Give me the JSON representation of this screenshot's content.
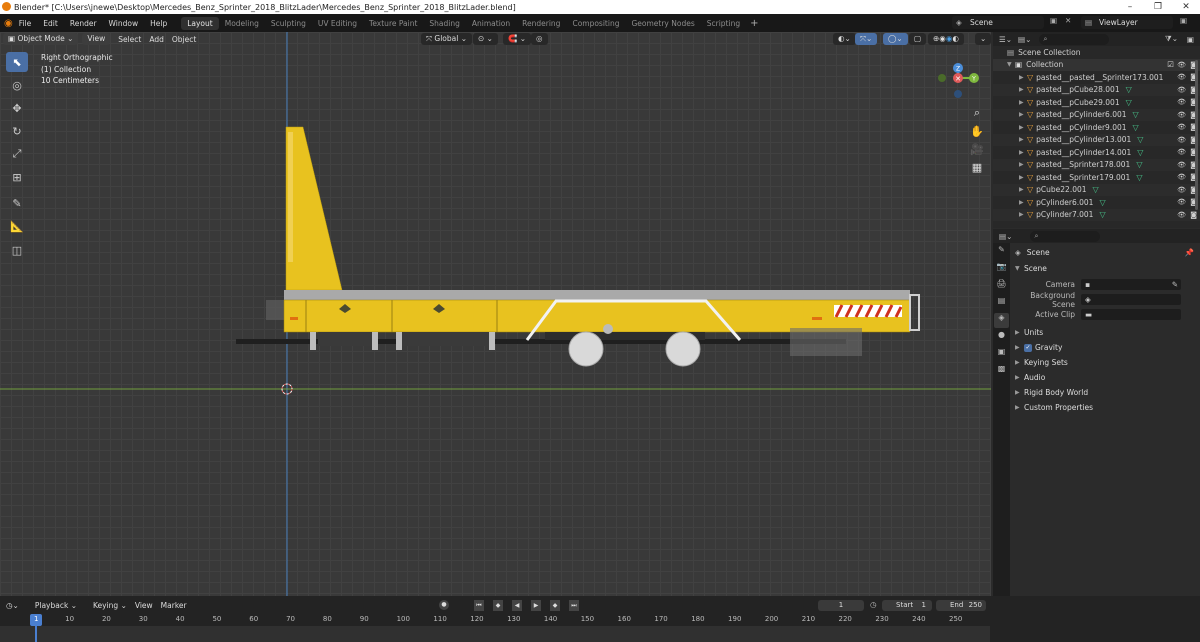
{
  "window": {
    "title": "Blender* [C:\\Users\\jnewe\\Desktop\\Mercedes_Benz_Sprinter_2018_BlitzLader\\Mercedes_Benz_Sprinter_2018_BlitzLader.blend]",
    "minimize": "–",
    "maximize": "❐",
    "close": "✕"
  },
  "menu": {
    "file": "File",
    "edit": "Edit",
    "render": "Render",
    "window": "Window",
    "help": "Help"
  },
  "workspaces": [
    "Layout",
    "Modeling",
    "Sculpting",
    "UV Editing",
    "Texture Paint",
    "Shading",
    "Animation",
    "Rendering",
    "Compositing",
    "Geometry Nodes",
    "Scripting"
  ],
  "scene_name": "Scene",
  "view_layer": "ViewLayer",
  "viewport": {
    "mode": "Object Mode",
    "view": "View",
    "select": "Select",
    "add": "Add",
    "object": "Object",
    "orientation": "Global",
    "overlay_info": [
      "Right Orthographic",
      "(1) Collection",
      "10 Centimeters"
    ]
  },
  "gizmo": {
    "z": "Z",
    "y": "Y"
  },
  "outliner": {
    "root": "Scene Collection",
    "collection": "Collection",
    "items": [
      {
        "name": "pasted__pasted__Sprinter173.001",
        "mesh": false
      },
      {
        "name": "pasted__pCube28.001",
        "mesh": true
      },
      {
        "name": "pasted__pCube29.001",
        "mesh": true
      },
      {
        "name": "pasted__pCylinder6.001",
        "mesh": true
      },
      {
        "name": "pasted__pCylinder9.001",
        "mesh": true
      },
      {
        "name": "pasted__pCylinder13.001",
        "mesh": true
      },
      {
        "name": "pasted__pCylinder14.001",
        "mesh": true
      },
      {
        "name": "pasted__Sprinter178.001",
        "mesh": true
      },
      {
        "name": "pasted__Sprinter179.001",
        "mesh": true
      },
      {
        "name": "pCube22.001",
        "mesh": true
      },
      {
        "name": "pCylinder6.001",
        "mesh": true
      },
      {
        "name": "pCylinder7.001",
        "mesh": true
      }
    ]
  },
  "properties": {
    "title": "Scene",
    "section": "Scene",
    "camera_label": "Camera",
    "background_label": "Background Scene",
    "clip_label": "Active Clip",
    "panels": [
      "Units",
      "Gravity",
      "Keying Sets",
      "Audio",
      "Rigid Body World",
      "Custom Properties"
    ]
  },
  "timeline": {
    "playback": "Playback",
    "keying": "Keying",
    "view": "View",
    "marker": "Marker",
    "current_frame": "1",
    "start_label": "Start",
    "start": "1",
    "end_label": "End",
    "end": "250",
    "ticks": [
      "1",
      "10",
      "20",
      "30",
      "40",
      "50",
      "60",
      "70",
      "80",
      "90",
      "100",
      "110",
      "120",
      "130",
      "140",
      "150",
      "160",
      "170",
      "180",
      "190",
      "200",
      "210",
      "220",
      "230",
      "240",
      "250"
    ]
  },
  "colors": {
    "accent": "#4a6fa5",
    "trailer": "#e8c21f",
    "x_axis": "#e05a5a",
    "y_axis": "#7fb83e",
    "z_axis": "#4b8ed9"
  }
}
